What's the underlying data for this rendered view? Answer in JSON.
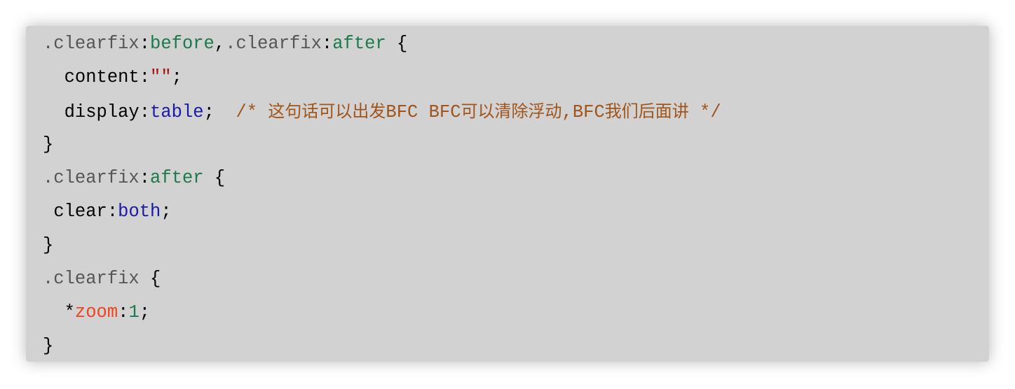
{
  "code": {
    "line1": {
      "sel1": ".clearfix",
      "colon1": ":",
      "pseudo1": "before",
      "comma": ",",
      "sel2": ".clearfix",
      "colon2": ":",
      "pseudo2": "after",
      "brace": " {"
    },
    "line2": {
      "indent": "  ",
      "prop": "content",
      "colon": ":",
      "value": "\"\"",
      "semi": ";"
    },
    "line3": {
      "indent": "  ",
      "prop": "display",
      "colon": ":",
      "value": "table",
      "semi": ";",
      "gap": "  ",
      "comment_open": "/* ",
      "comment_cjk1": "这句话可以出发",
      "comment_bfc1": "BFC BFC",
      "comment_cjk2": "可以清除浮动",
      "comment_bfc2": ",BFC",
      "comment_cjk3": "我们后面讲",
      "comment_close": " */"
    },
    "line4": {
      "brace": "}"
    },
    "line5": {
      "sel": ".clearfix",
      "colon": ":",
      "pseudo": "after",
      "brace": " {"
    },
    "line6": {
      "indent": " ",
      "prop": "clear",
      "colon": ":",
      "value": "both",
      "semi": ";"
    },
    "line7": {
      "brace": "}"
    },
    "line8": {
      "sel": ".clearfix",
      "brace": " {"
    },
    "line9": {
      "indent": "  ",
      "star": "*",
      "prop": "zoom",
      "colon": ":",
      "value": "1",
      "semi": ";"
    },
    "line10": {
      "brace": "}"
    }
  },
  "colors": {
    "background": "#d2d2d2",
    "selector": "#555555",
    "pseudo": "#1a7a4a",
    "string": "#a31515",
    "keyword": "#1a1aa6",
    "comment": "#a0541a",
    "hack": "#f0421c"
  }
}
